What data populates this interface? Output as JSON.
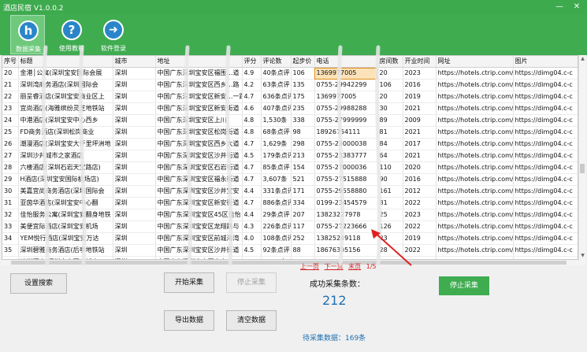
{
  "app": {
    "title": "酒店民宿 V1.0.0.2",
    "window_controls": {
      "minimize": "—",
      "close": "✕"
    }
  },
  "toolbar": {
    "items": [
      {
        "label": "数据采集",
        "icon": "h",
        "icon_name": "home-h-icon",
        "active": true
      },
      {
        "label": "使用教程",
        "icon": "?",
        "icon_name": "help-icon",
        "active": false
      },
      {
        "label": "软件登录",
        "icon": "➜",
        "icon_name": "arrow-right-icon",
        "active": false
      }
    ]
  },
  "table": {
    "columns": [
      "序号",
      "标题",
      "城市",
      "地址",
      "评分",
      "评论数",
      "起步价",
      "电话",
      "房间数",
      "开业时间",
      "网址",
      "图片"
    ],
    "rows": [
      [
        "20",
        "金港│公寓(深圳宝安国际会展",
        "深圳",
        "中国广东深圳宝安区福围…道",
        "4.9",
        "40条点评",
        "106",
        "1369977005",
        "20",
        "2023",
        "https://hotels.ctrip.com/h",
        "https://dimg04.c-c"
      ],
      [
        "21",
        "深圳湾商务酒店(深圳国际会",
        "深圳",
        "中国广东深圳宝安区西乡…路",
        "4.2",
        "63条点评",
        "135",
        "0755-29942299",
        "106",
        "2016",
        "https://hotels.ctrip.com/h",
        "https://dimg04.c-c"
      ],
      [
        "22",
        "丽呈睿酒店(深圳宝安商业区上",
        "深圳",
        "中国广东深圳宝安区新安…一路",
        "4.7",
        "636条点评",
        "175",
        "1369977005",
        "20",
        "2019",
        "https://hotels.ctrip.com/h",
        "https://dimg04.c-c"
      ],
      [
        "23",
        "宜尚酒店(海雅缤纷灵芝地铁站",
        "深圳",
        "中国广东深圳宝安区新安街道",
        "4.6",
        "407条点评",
        "235",
        "0755-29988288",
        "30",
        "2021",
        "https://hotels.ctrip.com/h",
        "https://dimg04.c-c"
      ],
      [
        "24",
        "中港酒店(深圳宝安中心西乡",
        "深圳",
        "中国广东深圳宝安区上川",
        "4.8",
        "1,530条",
        "338",
        "0755-27999999",
        "89",
        "2009",
        "https://hotels.ctrip.com/h",
        "https://dimg04.c-c"
      ],
      [
        "25",
        "FD商务酒店(深圳松岗商业",
        "深圳",
        "中国广东深圳宝安区松岗街道",
        "4.8",
        "68条点评",
        "98",
        "18926754111",
        "81",
        "2021",
        "https://hotels.ctrip.com/h",
        "https://dimg04.c-c"
      ],
      [
        "26",
        "潮漫酒店(深圳宝安大仟里坪洲地",
        "深圳",
        "中国广东深圳宝安区西乡大道",
        "4.7",
        "1,629条",
        "298",
        "0755-23000038",
        "84",
        "2017",
        "https://hotels.ctrip.com/h",
        "https://dimg04.c-c"
      ],
      [
        "27",
        "深圳沙井城市之家酒店",
        "深圳",
        "中国广东深圳宝安区沙井街道",
        "4.5",
        "179条点评",
        "213",
        "0755-23383777",
        "64",
        "2021",
        "https://hotels.ctrip.com/h",
        "https://dimg04.c-c"
      ],
      [
        "28",
        "六楼酒店(深圳石岩天宝路店)",
        "深圳",
        "中国广东深圳宝安区石岩街道",
        "4.7",
        "85条点评",
        "154",
        "0755-27000036",
        "110",
        "2020",
        "https://hotels.ctrip.com/h",
        "https://dimg04.c-c"
      ],
      [
        "29",
        "H酒店(深圳宝安国际机场店)",
        "深圳",
        "中国广东深圳宝安区福永街道",
        "4.7",
        "3,607条",
        "521",
        "0755-27515888",
        "90",
        "2016",
        "https://hotels.ctrip.com/h",
        "https://dimg04.c-c"
      ],
      [
        "30",
        "美嘉宜尚商务酒店(深圳国际会",
        "深圳",
        "中国广东深圳宝安区沙井宝安",
        "4.4",
        "331条点评",
        "171",
        "0755-29558880",
        "161",
        "2012",
        "https://hotels.ctrip.com/h",
        "https://dimg04.c-c"
      ],
      [
        "31",
        "亚茵华酒店(深圳宝安中心翻",
        "深圳",
        "中国广东深圳宝安区新安街道",
        "4.7",
        "886条点评",
        "334",
        "0199-23454579",
        "81",
        "2022",
        "https://hotels.ctrip.com/h",
        "https://dimg04.c-c"
      ],
      [
        "32",
        "佳怡服务公寓(深圳宝安翻身地铁",
        "深圳",
        "中国广东深圳宝安区45区佳怡",
        "4.4",
        "29条点评",
        "207",
        "13823227978",
        "25",
        "2023",
        "https://hotels.ctrip.com/h",
        "https://dimg04.c-c"
      ],
      [
        "33",
        "美便宜际酒店(深圳宝安机场",
        "深圳",
        "中国广东深圳宝安区龙翔路与",
        "4.3",
        "226条点评",
        "117",
        "0755-27223666",
        "126",
        "2022",
        "https://hotels.ctrip.com/h",
        "https://dimg04.c-c"
      ],
      [
        "34",
        "YEM悦行酒店(深圳宝安万达",
        "深圳",
        "中国广东深圳宝安区前城海湾",
        "4.0",
        "108条点评",
        "252",
        "13825249118",
        "23",
        "2019",
        "https://hotels.ctrip.com/h",
        "https://dimg04.c-c"
      ],
      [
        "35",
        "深圳碧雅商务酒店(后亭地铁站",
        "深圳",
        "中国广东深圳宝安区沙井街道",
        "4.5",
        "92条点评",
        "88",
        "18676305156",
        "28",
        "2022",
        "https://hotels.ctrip.com/h",
        "https://dimg04.c-c"
      ],
      [
        "36",
        "迪祥酒店(深圳宝安西方城店)",
        "深圳",
        "中国广东深圳宝安区宝安中",
        "4.5",
        "1,655条",
        "291",
        "0755-83378888",
        "5",
        "2016",
        "https://hotels.ctrip.com/h",
        "https://dimg04.c-c"
      ]
    ],
    "selected_cell": {
      "row": 0,
      "col": 7
    }
  },
  "pager": {
    "prev": "上一页",
    "next": "下一页",
    "last": "末页",
    "page_indicator": "1/5"
  },
  "actions": {
    "search_settings": "设置搜索",
    "start": "开始采集",
    "stop": "停止采集",
    "export": "导出数据",
    "clear": "清空数据",
    "stop_collect": "停止采集"
  },
  "stats": {
    "success_label": "成功采集条数：",
    "success_count": "212",
    "pending": "待采集数据：169条"
  },
  "colors": {
    "brand_green": "#3fac50",
    "link_red": "#d21f1f",
    "stat_blue": "#1f6fb2",
    "annotation_red": "#e02020"
  }
}
